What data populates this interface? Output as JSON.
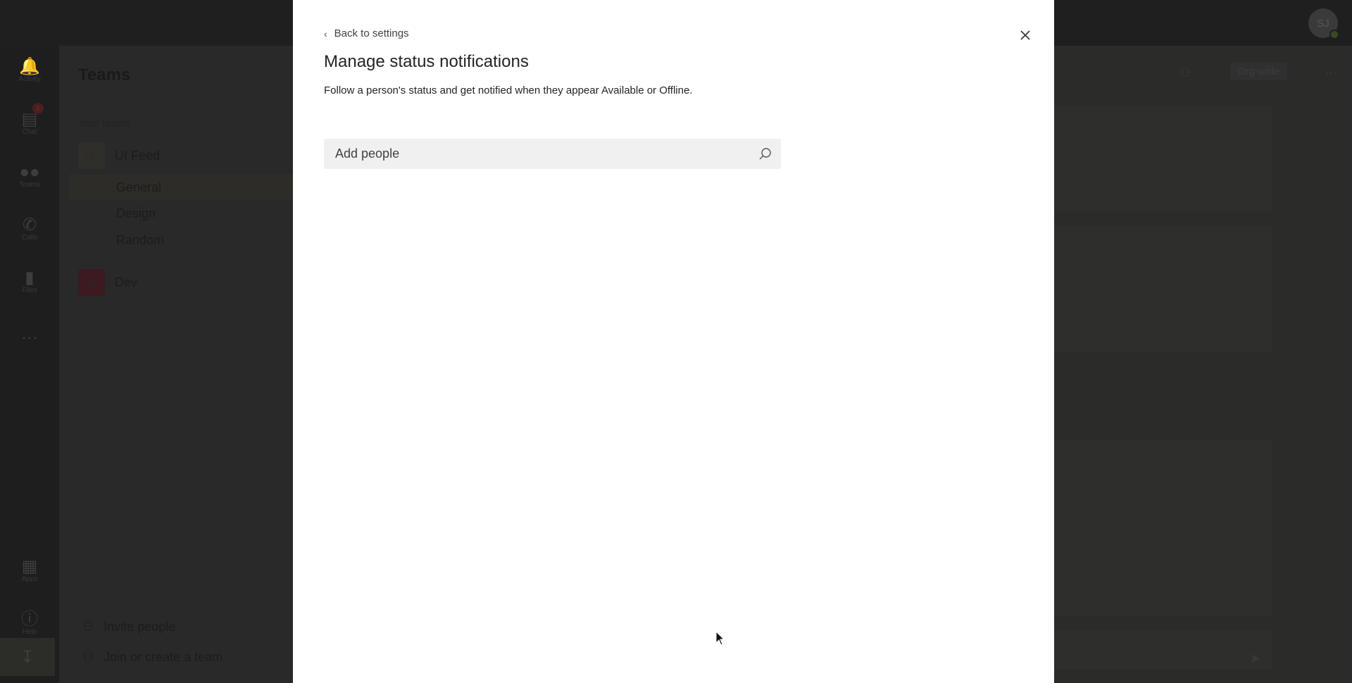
{
  "topbar": {
    "avatar_initials": "SJ"
  },
  "rail": {
    "items": [
      {
        "label": "Activity",
        "icon": "bell-icon"
      },
      {
        "label": "Chat",
        "icon": "chat-icon",
        "badge": "1"
      },
      {
        "label": "Teams",
        "icon": "teams-icon"
      },
      {
        "label": "Calls",
        "icon": "phone-icon"
      },
      {
        "label": "Files",
        "icon": "file-icon"
      },
      {
        "label": "Apps",
        "icon": "apps-icon"
      },
      {
        "label": "Help",
        "icon": "help-icon"
      }
    ]
  },
  "sidebar": {
    "title": "Teams",
    "section": "Your teams",
    "teams": [
      {
        "initials": "UF",
        "name": "UI Feed"
      },
      {
        "initials": "D",
        "name": "Dev"
      }
    ],
    "channels": [
      "General",
      "Design",
      "Random"
    ],
    "invite": "Invite people",
    "join": "Join or create a team"
  },
  "main": {
    "org_wide": "Org-wide"
  },
  "modal": {
    "back": "Back to settings",
    "title": "Manage status notifications",
    "description": "Follow a person's status and get notified when they appear Available or Offline.",
    "search_placeholder": "Add people"
  }
}
